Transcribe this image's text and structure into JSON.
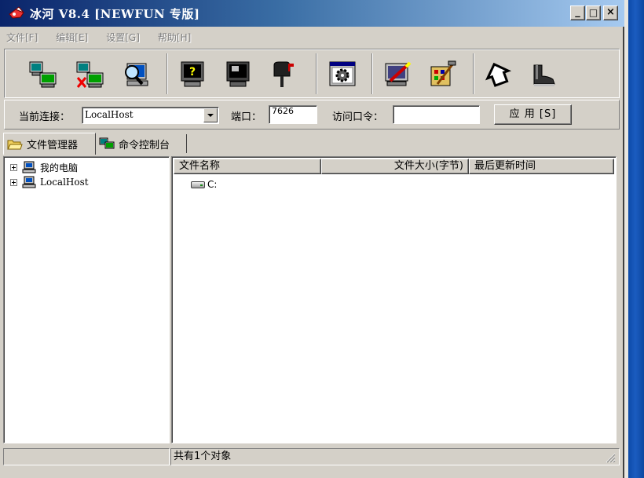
{
  "window": {
    "title": "冰河 V8.4 [NEWFUN 专版]",
    "controls": {
      "minimize": "_",
      "maximize": "□",
      "close": "×"
    }
  },
  "menu": [
    {
      "label": "文件[F]"
    },
    {
      "label": "编辑[E]"
    },
    {
      "label": "设置[G]"
    },
    {
      "label": "帮助[H]"
    }
  ],
  "toolbar": {
    "buttons": [
      {
        "icon": "add-host-icon"
      },
      {
        "icon": "remove-host-icon"
      },
      {
        "icon": "search-host-icon"
      },
      {
        "icon": "help-monitor-icon"
      },
      {
        "icon": "screen-capture-icon"
      },
      {
        "icon": "mailbox-icon"
      },
      {
        "icon": "settings-gear-icon"
      },
      {
        "icon": "remote-edit-icon"
      },
      {
        "icon": "config-tools-icon"
      },
      {
        "icon": "home-icon"
      },
      {
        "icon": "exit-boot-icon"
      }
    ]
  },
  "connection": {
    "current_label": "当前连接：",
    "current_value": "LocalHost",
    "port_label": "端口：",
    "port_value": "7626",
    "password_label": "访问口令：",
    "password_value": "",
    "apply_label": "应 用 [S]"
  },
  "tabs": [
    {
      "label": "文件管理器",
      "icon": "folder-open-icon",
      "active": true
    },
    {
      "label": "命令控制台",
      "icon": "console-icon",
      "active": false
    }
  ],
  "tree": [
    {
      "label": "我的电脑"
    },
    {
      "label": "LocalHost"
    }
  ],
  "file_list": {
    "columns": [
      "文件名称",
      "文件大小(字节)",
      "最后更新时间"
    ],
    "rows": [
      {
        "name": "C:"
      }
    ]
  },
  "status": {
    "left": "",
    "message": "共有1个对象"
  }
}
